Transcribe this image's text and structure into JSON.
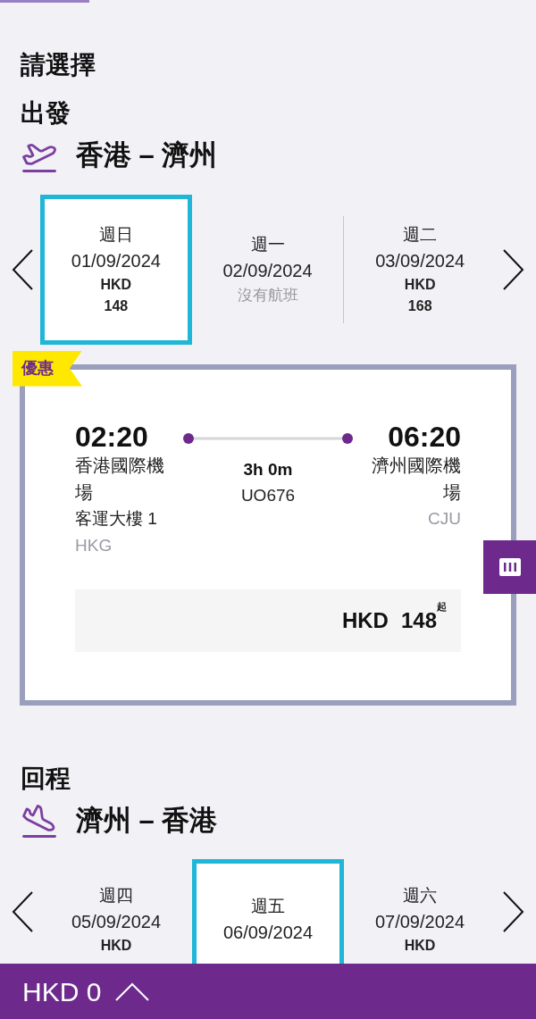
{
  "title": "請選擇",
  "sections": [
    {
      "kind": "depart",
      "heading": "出發",
      "route": "香港 – 濟州",
      "dates": [
        {
          "weekday": "週日",
          "date": "01/09/2024",
          "currency": "HKD",
          "price": "148",
          "selected": true
        },
        {
          "weekday": "週一",
          "date": "02/09/2024",
          "note": "沒有航班",
          "selected": false
        },
        {
          "weekday": "週二",
          "date": "03/09/2024",
          "currency": "HKD",
          "price": "168",
          "selected": false
        }
      ],
      "flight": {
        "badge": "優惠",
        "departure": {
          "time": "02:20",
          "airport": "香港國際機場",
          "terminal": "客運大樓 1",
          "code": "HKG"
        },
        "duration": "3h 0m",
        "flight_number": "UO676",
        "arrival": {
          "time": "06:20",
          "airport": "濟州國際機場",
          "code": "CJU"
        },
        "fare": {
          "currency": "HKD",
          "amount": "148",
          "suffix": "起"
        }
      }
    },
    {
      "kind": "return",
      "heading": "回程",
      "route": "濟州 – 香港",
      "dates": [
        {
          "weekday": "週四",
          "date": "05/09/2024",
          "currency": "HKD",
          "selected": false
        },
        {
          "weekday": "週五",
          "date": "06/09/2024",
          "selected": true
        },
        {
          "weekday": "週六",
          "date": "07/09/2024",
          "currency": "HKD",
          "selected": false
        }
      ]
    }
  ],
  "footer": {
    "total": "HKD 0"
  }
}
